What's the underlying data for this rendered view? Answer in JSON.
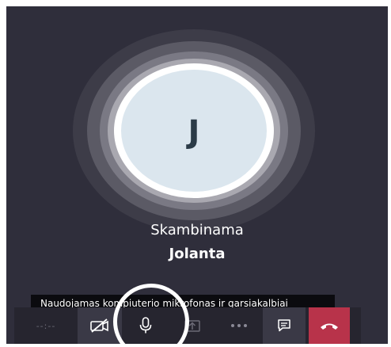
{
  "call": {
    "avatar_initial": "J",
    "status": "Skambinama",
    "callee_name": "Jolanta",
    "audio_tooltip": "Naudojamas kompiuterio mikrofonas ir garsiakalbiai"
  },
  "toolbar": {
    "timer": "--:--",
    "buttons": [
      {
        "name": "video-off",
        "icon": "video-off-icon"
      },
      {
        "name": "microphone",
        "icon": "microphone-icon"
      },
      {
        "name": "share",
        "icon": "share-screen-icon"
      },
      {
        "name": "more",
        "icon": "more-icon"
      },
      {
        "name": "chat",
        "icon": "chat-icon"
      },
      {
        "name": "hang-up",
        "icon": "hang-up-icon"
      }
    ]
  },
  "colors": {
    "background": "#2f2e3b",
    "toolbar": "#26252f",
    "avatar": "#dbe6ee",
    "hangup": "#b8334a"
  }
}
